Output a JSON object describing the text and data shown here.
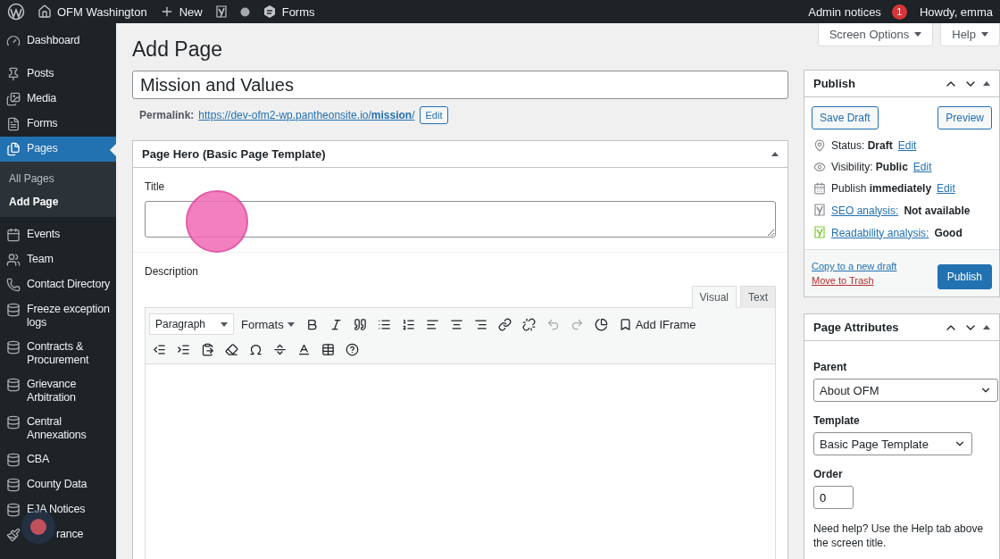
{
  "admin_bar": {
    "site": "OFM Washington",
    "new": "New",
    "forms": "Forms",
    "notices": "Admin notices",
    "notice_count": "1",
    "howdy": "Howdy, emma"
  },
  "sidebar": {
    "items": [
      {
        "label": "Dashboard",
        "kind": "dashboard",
        "selected": false
      },
      {
        "label": "Posts",
        "kind": "pin",
        "selected": false
      },
      {
        "label": "Media",
        "kind": "media",
        "selected": false
      },
      {
        "label": "Forms",
        "kind": "form",
        "selected": false
      },
      {
        "label": "Pages",
        "kind": "pages",
        "selected": true,
        "children": [
          {
            "label": "All Pages",
            "selected": false
          },
          {
            "label": "Add Page",
            "selected": true
          }
        ]
      },
      {
        "label": "Events",
        "kind": "calendar",
        "selected": false
      },
      {
        "label": "Team",
        "kind": "team",
        "selected": false
      },
      {
        "label": "Contact Directory",
        "kind": "phone",
        "selected": false
      },
      {
        "label": "Freeze exception logs",
        "kind": "database",
        "selected": false
      },
      {
        "label": "Contracts & Procurement",
        "kind": "database",
        "selected": false
      },
      {
        "label": "Grievance Arbitration",
        "kind": "database",
        "selected": false
      },
      {
        "label": "Central Annexations",
        "kind": "database",
        "selected": false
      },
      {
        "label": "CBA",
        "kind": "database",
        "selected": false
      },
      {
        "label": "County Data",
        "kind": "database",
        "selected": false
      },
      {
        "label": "EJA Notices",
        "kind": "database",
        "selected": false
      },
      {
        "label": "rance",
        "kind": "brush",
        "selected": false
      }
    ]
  },
  "header_buttons": [
    "Screen Options",
    "Help"
  ],
  "heading": "Add Page",
  "title_value": "Mission and Values",
  "permalink": {
    "label": "Permalink:",
    "url": "https://dev-ofm2-wp.pantheonsite.io/**mission**/",
    "button": "Edit"
  },
  "hero_box": {
    "title": "Page Hero (Basic Page Template)",
    "title_label": "Title",
    "description_label": "Description",
    "tabs": [
      {
        "label": "Visual",
        "selected": true
      },
      {
        "label": "Text",
        "selected": false
      }
    ],
    "toolbar": {
      "block_format": "Paragraph",
      "formats": "Formats",
      "iframe": "Add IFrame",
      "history_disabled": true
    }
  },
  "publish": {
    "title": "Publish",
    "save_draft": "Save Draft",
    "preview": "Preview",
    "rows": [
      {
        "kind": "status",
        "text": "Status: **Draft**",
        "link": "Edit"
      },
      {
        "kind": "visibility",
        "text": "Visibility: **Public**",
        "link": "Edit"
      },
      {
        "kind": "schedule",
        "text": "Publish **immediately**",
        "link": "Edit"
      },
      {
        "kind": "seo",
        "link": "SEO analysis:",
        "text": "Not available"
      },
      {
        "kind": "readability",
        "link": "Readability analysis:",
        "text": "Good"
      }
    ],
    "copy_link": "Copy to a new draft",
    "trash_link": "Move to Trash",
    "publish_button": "Publish"
  },
  "attributes": {
    "title": "Page Attributes",
    "parent_label": "Parent",
    "parent_value": "About OFM",
    "template_label": "Template",
    "template_value": "Basic Page Template",
    "order_label": "Order",
    "order_value": "0",
    "help": "Need help? Use the Help tab above the screen title."
  },
  "click_indicators": [
    {
      "color": "#f06bb4"
    },
    {
      "color": "#c0505c"
    }
  ]
}
